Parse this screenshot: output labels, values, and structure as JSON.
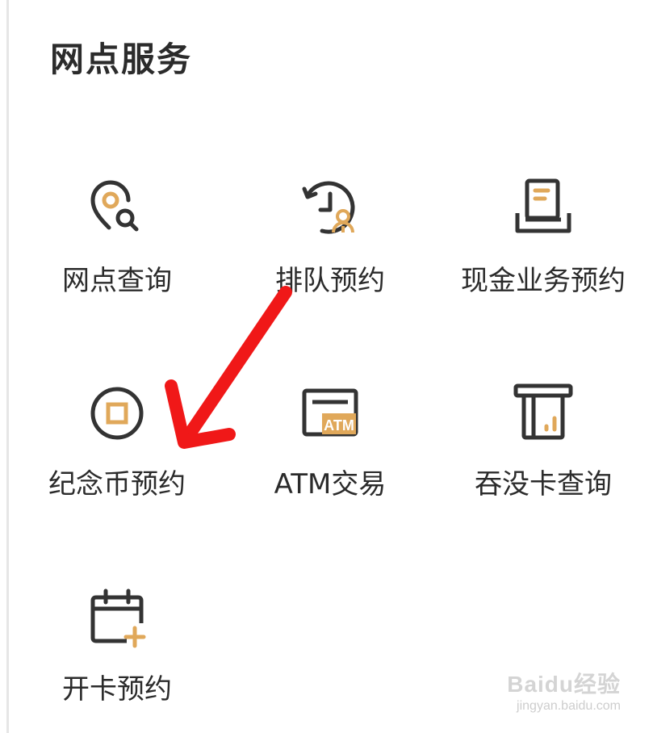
{
  "section": {
    "title": "网点服务"
  },
  "services": [
    {
      "label": "网点查询",
      "icon": "location-search-icon"
    },
    {
      "label": "排队预约",
      "icon": "queue-clock-icon"
    },
    {
      "label": "现金业务预约",
      "icon": "cash-document-icon"
    },
    {
      "label": "纪念币预约",
      "icon": "coin-icon"
    },
    {
      "label": "ATM交易",
      "icon": "atm-icon"
    },
    {
      "label": "吞没卡查询",
      "icon": "card-slot-icon"
    },
    {
      "label": "开卡预约",
      "icon": "calendar-plus-icon"
    }
  ],
  "colors": {
    "icon_dark": "#333333",
    "icon_accent": "#e0a85a",
    "arrow": "#f01818",
    "text": "#2b2b2b"
  },
  "watermark": {
    "brand": "Baidu经验",
    "url": "jingyan.baidu.com"
  }
}
